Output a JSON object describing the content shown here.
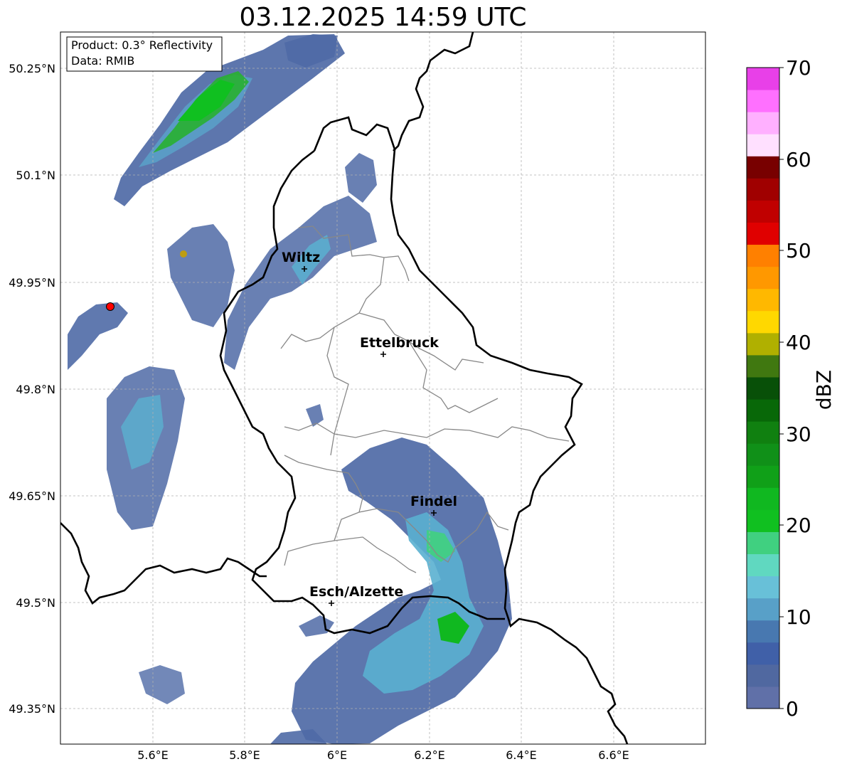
{
  "title": "03.12.2025 14:59 UTC",
  "info_box": {
    "product": "Product: 0.3° Reflectivity",
    "data": "Data: RMIB"
  },
  "map": {
    "lon_range": [
      5.4,
      6.8
    ],
    "lat_range": [
      49.3,
      50.3
    ],
    "lon_ticks": [
      "5.6°E",
      "5.8°E",
      "6°E",
      "6.2°E",
      "6.4°E",
      "6.6°E"
    ],
    "lat_ticks": [
      "50.25°N",
      "50.1°N",
      "49.95°N",
      "49.8°N",
      "49.65°N",
      "49.5°N",
      "49.35°N"
    ],
    "gridlines": true,
    "radar_site_color": "#ff0000"
  },
  "cities": [
    {
      "name": "Wiltz",
      "lon": 5.93,
      "lat": 49.966
    },
    {
      "name": "Ettelbruck",
      "lon": 6.1,
      "lat": 49.847
    },
    {
      "name": "Findel",
      "lon": 6.21,
      "lat": 49.626
    },
    {
      "name": "Esch/Alzette",
      "lon": 5.99,
      "lat": 49.497
    }
  ],
  "colorbar": {
    "label": "dBZ",
    "ticks": [
      "0",
      "10",
      "20",
      "30",
      "40",
      "50",
      "60",
      "70"
    ],
    "colors": [
      "#6070a8",
      "#5068a0",
      "#4060a8",
      "#4878b0",
      "#58a0c8",
      "#68c0d8",
      "#60d8c0",
      "#40d080",
      "#10c020",
      "#10b820",
      "#10a018",
      "#109018",
      "#108010",
      "#086808",
      "#085008",
      "#407810",
      "#b0b000",
      "#ffd800",
      "#ffb800",
      "#ff9800",
      "#ff8000",
      "#e00000",
      "#c00000",
      "#a00000",
      "#780000",
      "#ffe0ff",
      "#ffb0ff",
      "#ff70ff",
      "#e840e8"
    ]
  }
}
